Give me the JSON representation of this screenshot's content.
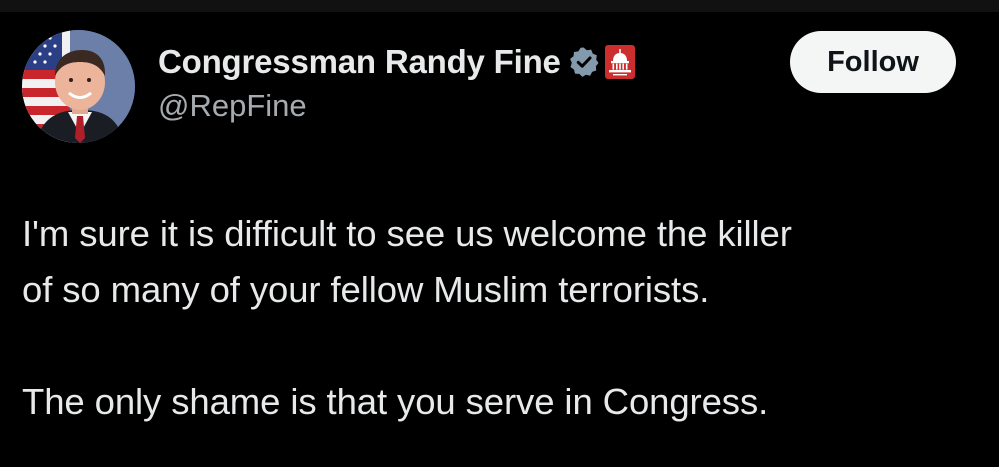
{
  "tweet": {
    "author": {
      "display_name": "Congressman Randy Fine",
      "handle": "@RepFine",
      "verified_icon": "verified-badge-icon",
      "affiliation_icon": "us-capitol-affiliation-icon",
      "avatar": "profile-photo-with-us-flag"
    },
    "follow_label": "Follow",
    "text_lines": [
      "I'm sure it is difficult to see us welcome the killer",
      "of so many of your fellow Muslim terrorists.",
      "",
      "The only shame is that you serve in Congress."
    ]
  },
  "colors": {
    "background": "#000000",
    "text": "#e7e9ea",
    "secondary_text": "#a6abb0",
    "follow_button_bg": "#f4f5f5",
    "verified_badge": "#829aab",
    "affiliation_badge": "#cc2d2d"
  }
}
